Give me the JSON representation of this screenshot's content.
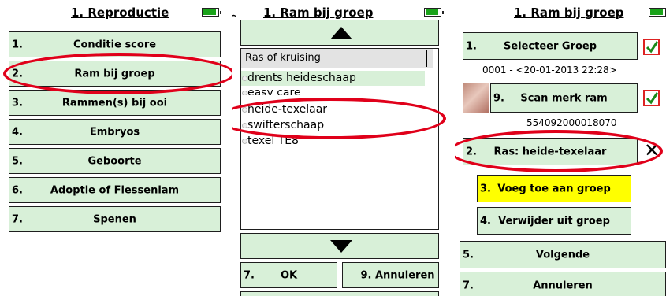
{
  "screen1": {
    "title": "1. Reproductie",
    "menu": [
      {
        "num": "1.",
        "label": "Conditie score"
      },
      {
        "num": "2.",
        "label": "Ram bij groep"
      },
      {
        "num": "3.",
        "label": "Rammen(s) bij ooi"
      },
      {
        "num": "4.",
        "label": "Embryos"
      },
      {
        "num": "5.",
        "label": "Geboorte"
      },
      {
        "num": "6.",
        "label": "Adoptie of Flessenlam"
      },
      {
        "num": "7.",
        "label": "Spenen"
      }
    ]
  },
  "screen2": {
    "title": "1. Ram bij groep",
    "list_header": "Ras of kruising",
    "items": [
      "drents heideschaap",
      "easy care",
      "heide-texelaar",
      "swifterschaap",
      "texel TE8"
    ],
    "ok": {
      "num": "7.",
      "label": "OK"
    },
    "cancel": {
      "num": "9.",
      "label": "Annuleren"
    }
  },
  "screen3": {
    "title": "1. Ram bij groep",
    "select_group": {
      "num": "1.",
      "label": "Selecteer Groep"
    },
    "group_info": "0001 - <20-01-2013 22:28>",
    "scan_ram": {
      "num": "9.",
      "label": "Scan merk ram"
    },
    "ram_id": "554092000018070",
    "ras": {
      "num": "2.",
      "label": "Ras: heide-texelaar"
    },
    "add_group": {
      "num": "3.",
      "label": "Voeg toe aan groep"
    },
    "remove_group": {
      "num": "4.",
      "label": "Verwijder uit groep"
    },
    "next": {
      "num": "5.",
      "label": "Volgende"
    },
    "cancel": {
      "num": "7.",
      "label": "Annuleren"
    }
  },
  "colors": {
    "button_bg": "#d8f0d8",
    "highlight_bg": "#ffff00",
    "oval": "#e0001a",
    "check": "#1a8a1a",
    "battery": "#1aa31a"
  },
  "icons": [
    "battery-icon",
    "up-arrow-icon",
    "down-arrow-icon",
    "checkmark-icon",
    "close-x-icon",
    "ram-photo-icon"
  ]
}
